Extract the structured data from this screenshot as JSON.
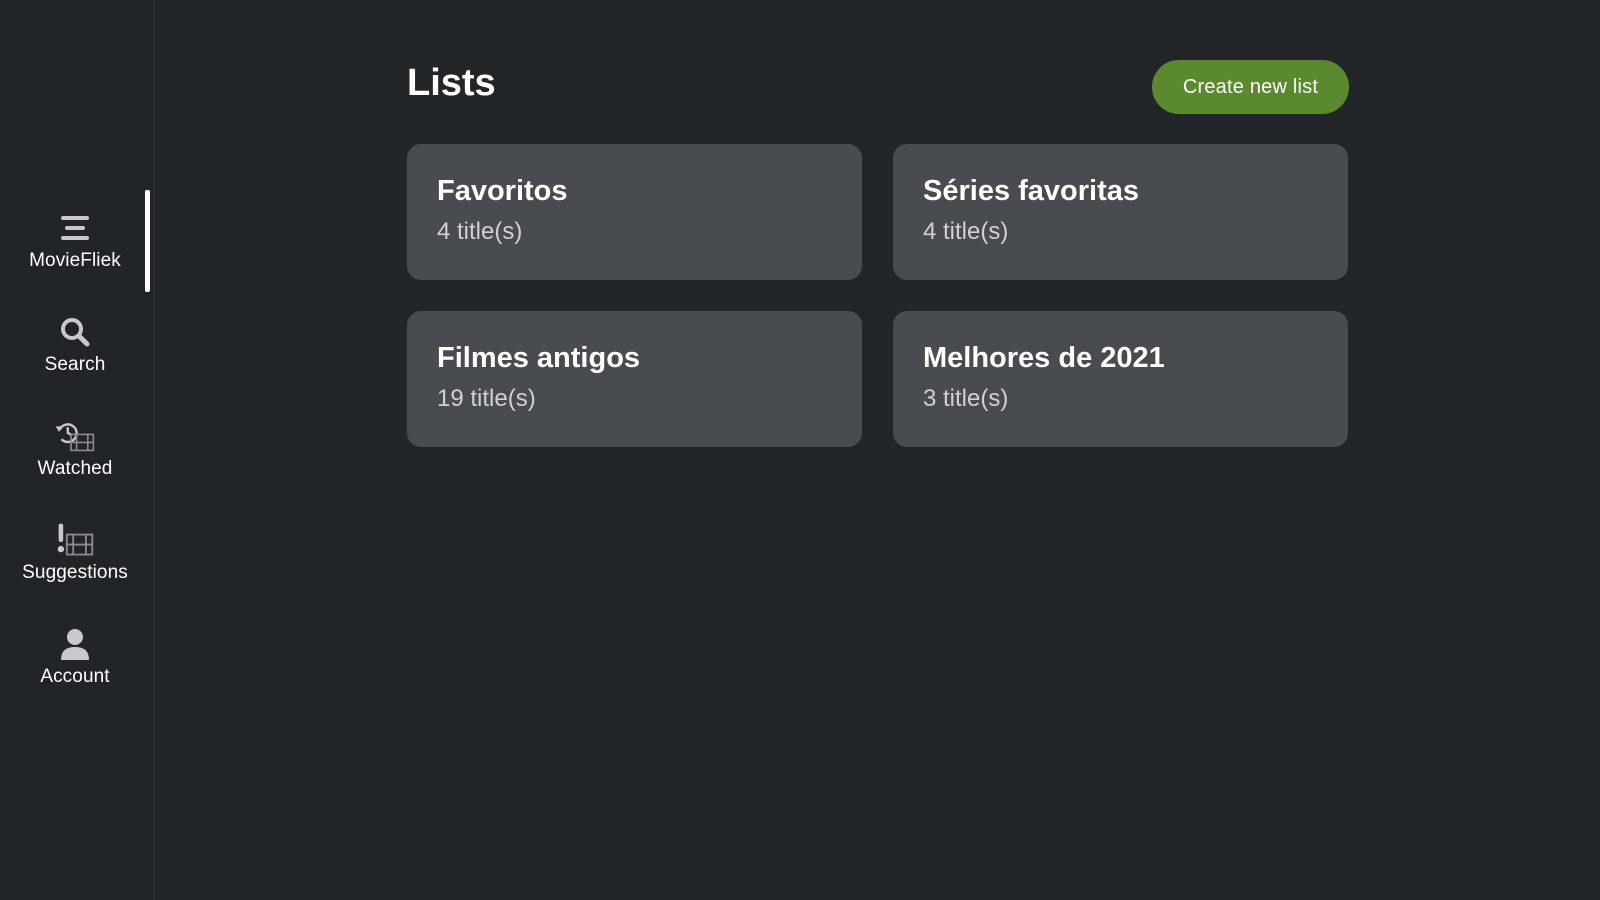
{
  "sidebar": {
    "items": [
      {
        "label": "MovieFliek",
        "icon": "menu-icon",
        "active": true
      },
      {
        "label": "Search",
        "icon": "search-icon",
        "active": false
      },
      {
        "label": "Watched",
        "icon": "history-film-icon",
        "active": false
      },
      {
        "label": "Suggestions",
        "icon": "suggestion-film-icon",
        "active": false
      },
      {
        "label": "Account",
        "icon": "person-icon",
        "active": false
      }
    ]
  },
  "main": {
    "title": "Lists",
    "create_button_label": "Create new list",
    "lists": [
      {
        "name": "Favoritos",
        "count": "4 title(s)"
      },
      {
        "name": "Séries favoritas",
        "count": "4 title(s)"
      },
      {
        "name": "Filmes antigos",
        "count": "19 title(s)"
      },
      {
        "name": "Melhores de 2021",
        "count": "3 title(s)"
      }
    ]
  },
  "colors": {
    "background": "#232629",
    "sidebar": "#222528",
    "card": "#484b50",
    "accent_button": "#5b8a2e",
    "icon": "#c8c9cb"
  }
}
